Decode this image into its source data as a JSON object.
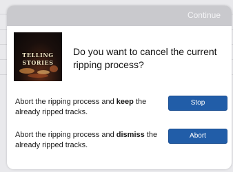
{
  "dialog": {
    "continue_label": "Continue",
    "album_art": {
      "line1": "TELLING",
      "line2": "STORIES"
    },
    "question": "Do you want to cancel the current ripping process?",
    "options": [
      {
        "text_before": "Abort the ripping process and ",
        "text_bold": "keep",
        "text_after": " the already ripped tracks.",
        "button_label": "Stop"
      },
      {
        "text_before": "Abort the ripping process and ",
        "text_bold": "dismiss",
        "text_after": " the already ripped tracks.",
        "button_label": "Abort"
      }
    ]
  },
  "colors": {
    "button": "#215da8",
    "titlebar": "#c9c9cd",
    "backdrop": "#e9e9ec"
  }
}
